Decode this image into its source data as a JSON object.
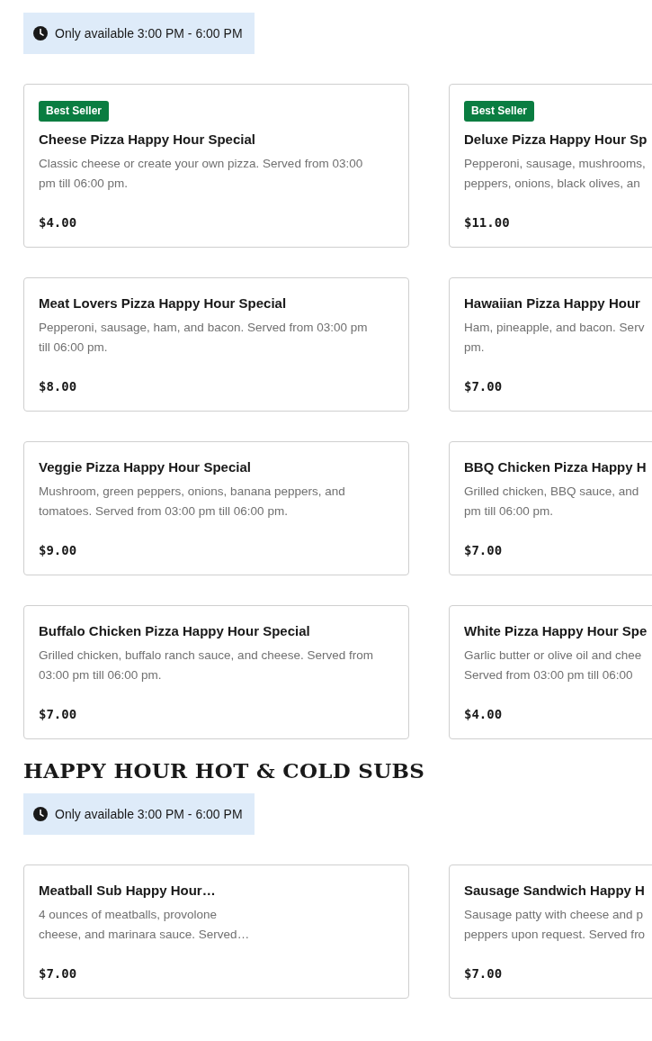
{
  "sections": [
    {
      "availability": "Only available 3:00 PM - 6:00 PM",
      "items": [
        {
          "badge": "Best Seller",
          "title": "Cheese Pizza Happy Hour Special",
          "desc_lines": [
            "Classic cheese or create your own pizza. Served from 03:00",
            "pm till 06:00 pm."
          ],
          "price": "$4.00"
        },
        {
          "badge": "Best Seller",
          "title": "Deluxe Pizza Happy Hour Sp",
          "desc_lines": [
            "Pepperoni, sausage, mushrooms,",
            "peppers, onions, black olives, an"
          ],
          "price": "$11.00"
        },
        {
          "title": "Meat Lovers Pizza Happy Hour Special",
          "desc_lines": [
            "Pepperoni, sausage, ham, and bacon. Served from 03:00 pm",
            "till 06:00 pm."
          ],
          "price": "$8.00"
        },
        {
          "title": "Hawaiian Pizza Happy Hour",
          "desc_lines": [
            "Ham, pineapple, and bacon. Serv",
            "pm."
          ],
          "price": "$7.00"
        },
        {
          "title": "Veggie Pizza Happy Hour Special",
          "desc_lines": [
            "Mushroom, green peppers, onions, banana peppers, and",
            "tomatoes. Served from 03:00 pm till 06:00 pm."
          ],
          "price": "$9.00"
        },
        {
          "title": "BBQ Chicken Pizza Happy H",
          "desc_lines": [
            "Grilled chicken, BBQ sauce, and",
            "pm till 06:00 pm."
          ],
          "price": "$7.00"
        },
        {
          "title": "Buffalo Chicken Pizza Happy Hour Special",
          "desc_lines": [
            "Grilled chicken, buffalo ranch sauce, and cheese. Served from",
            "03:00 pm till 06:00 pm."
          ],
          "price": "$7.00"
        },
        {
          "title": "White Pizza Happy Hour Spe",
          "desc_lines": [
            "Garlic butter or olive oil and chee",
            "Served from 03:00 pm till 06:00"
          ],
          "price": "$4.00"
        }
      ]
    },
    {
      "heading": "HAPPY HOUR HOT & COLD SUBS",
      "availability": "Only available 3:00 PM - 6:00 PM",
      "items": [
        {
          "title": "Meatball Sub Happy Hour…",
          "desc_lines": [
            "4 ounces of meatballs, provolone",
            "cheese, and marinara sauce. Served…"
          ],
          "price": "$7.00"
        },
        {
          "title": "Sausage Sandwich Happy H",
          "desc_lines": [
            "Sausage patty with cheese and p",
            "peppers upon request. Served fro"
          ],
          "price": "$7.00"
        }
      ]
    }
  ]
}
